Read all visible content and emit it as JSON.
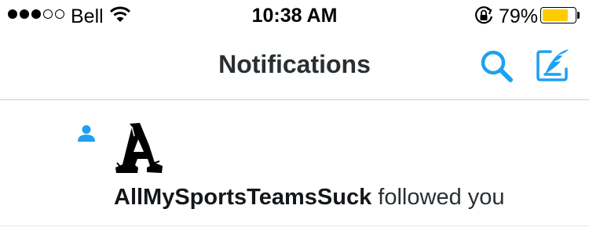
{
  "status_bar": {
    "carrier": "Bell",
    "time": "10:38 AM",
    "battery_percent": "79%",
    "battery_level": 0.79,
    "signal_bars_filled": 3,
    "signal_bars_total": 5,
    "battery_color": "#ffcc00"
  },
  "nav": {
    "title": "Notifications",
    "accent_color": "#1da1f2",
    "icons": [
      "search-icon",
      "compose-tweet-icon"
    ]
  },
  "notifications": [
    {
      "type": "follow",
      "icon": "person-icon",
      "avatar": "letter-a-logo",
      "username": "AllMySportsTeamsSuck",
      "action": "followed you"
    }
  ]
}
